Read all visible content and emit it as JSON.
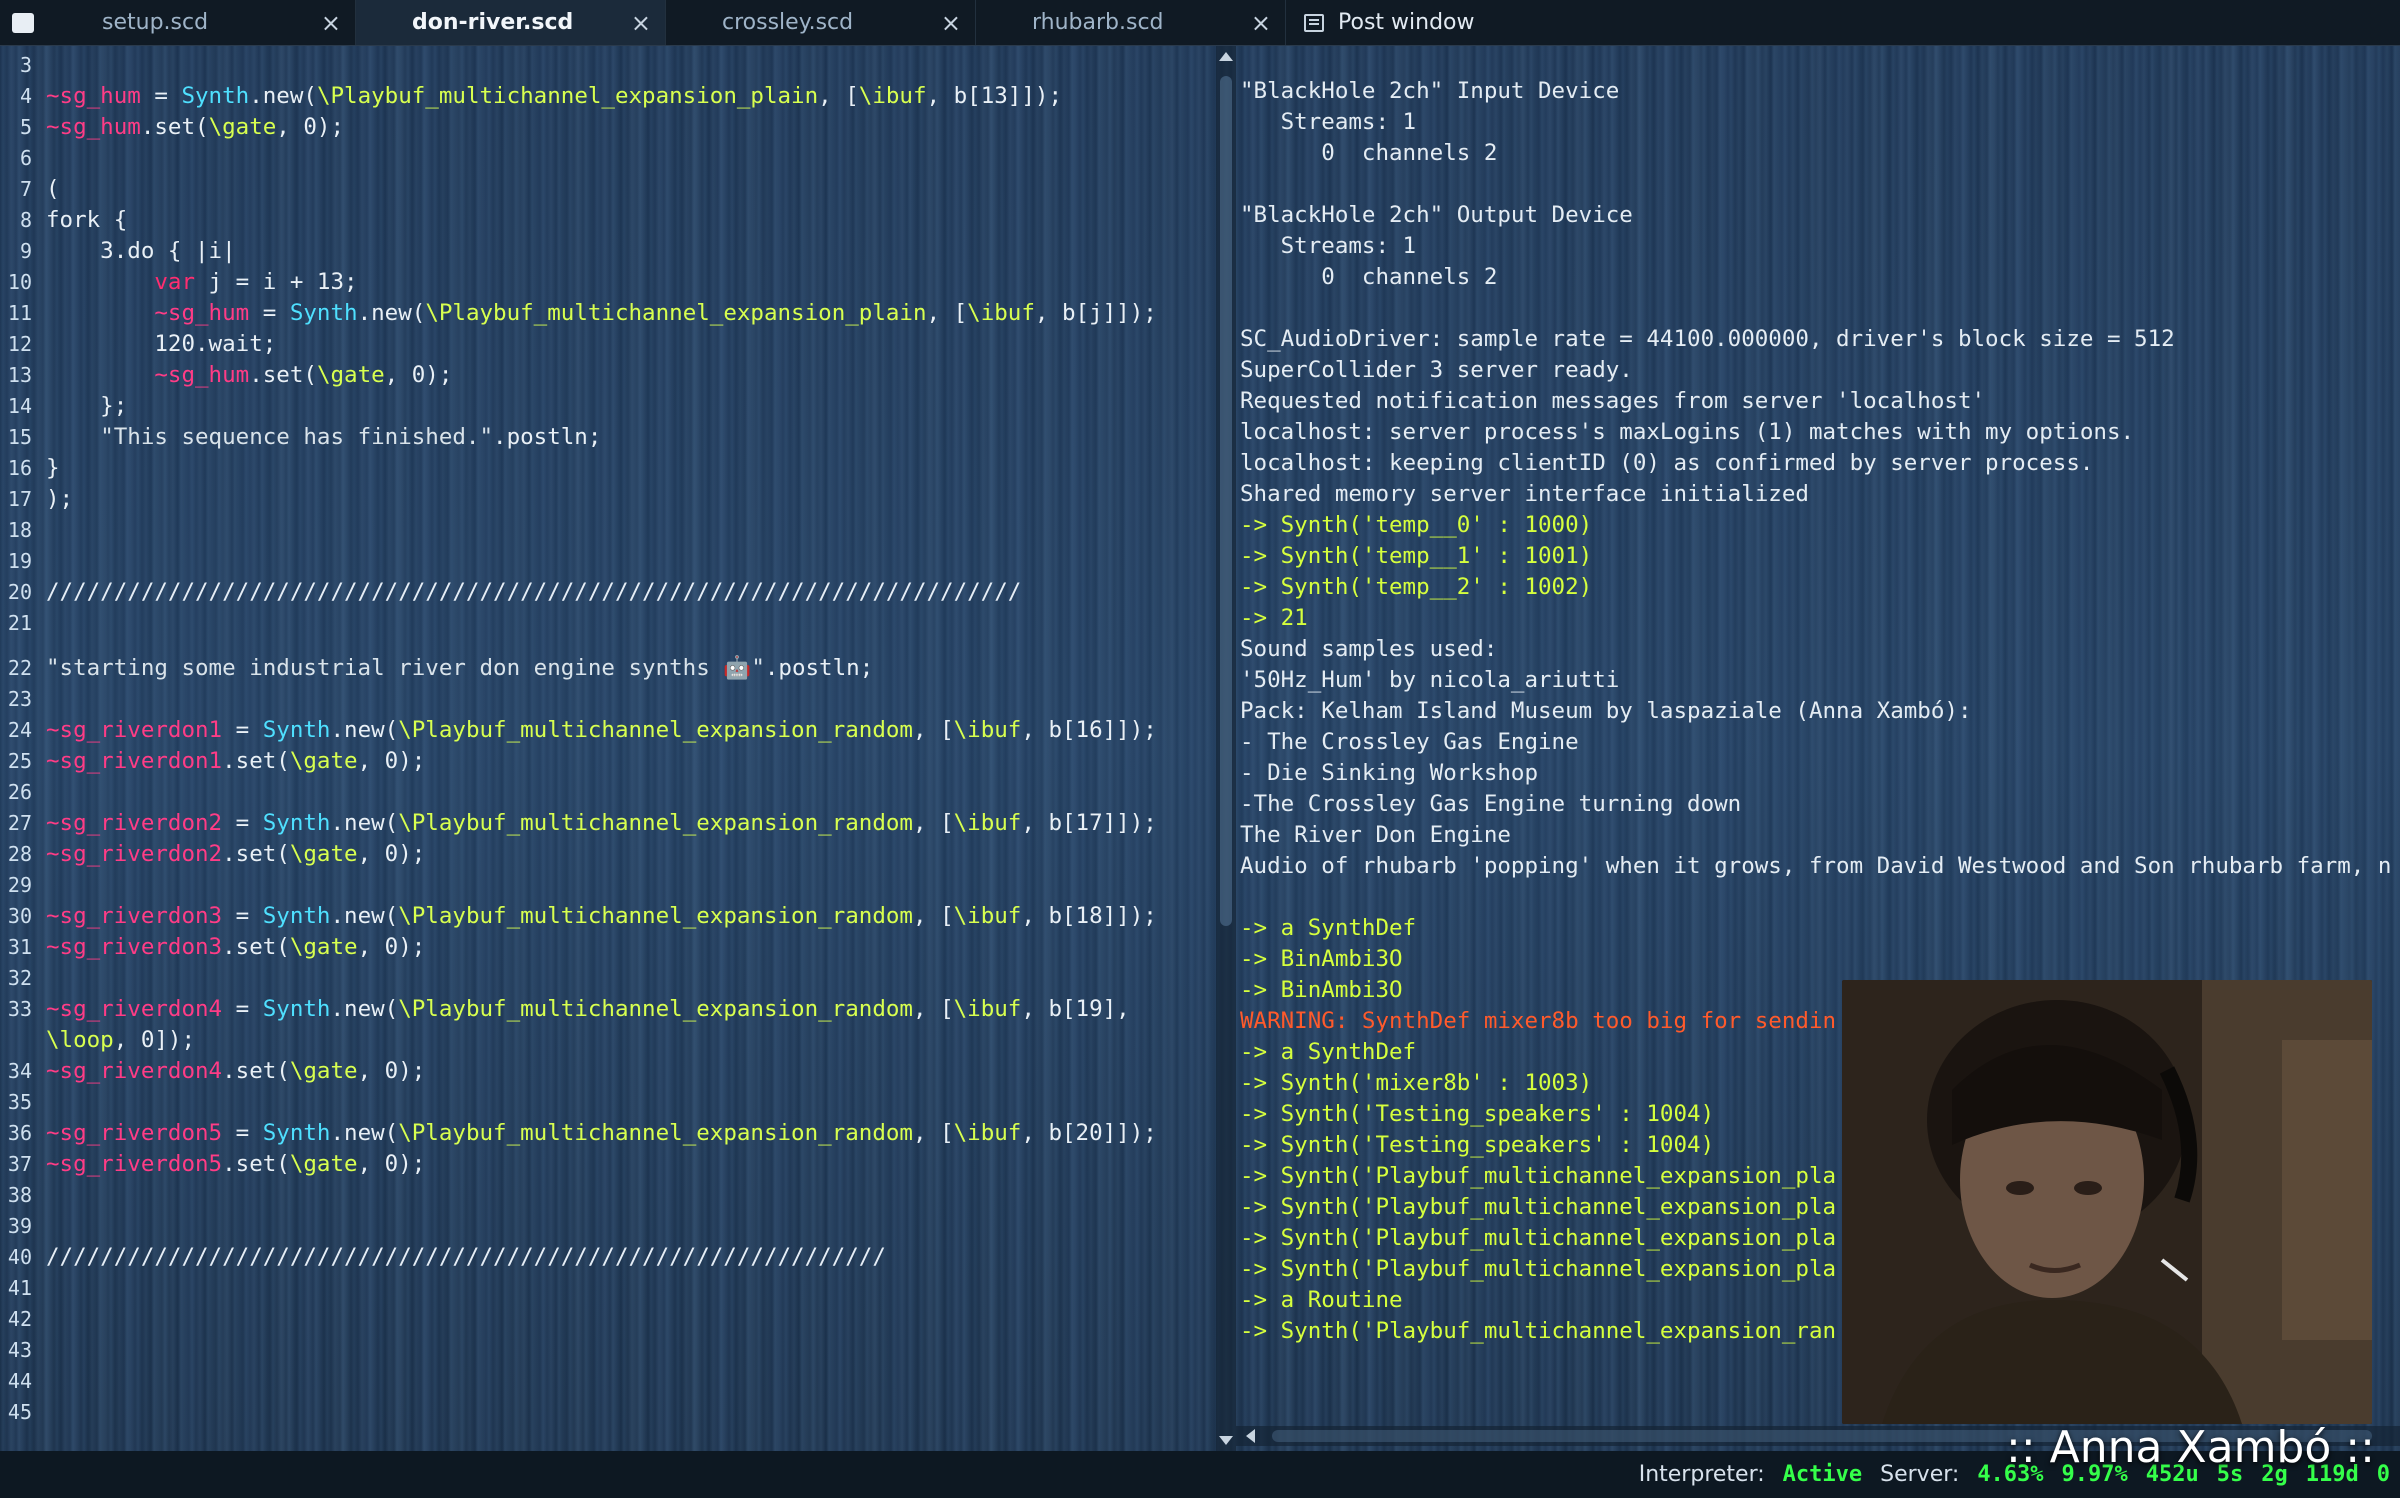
{
  "tabs": [
    {
      "label": "setup.scd",
      "close": "×"
    },
    {
      "label": "don-river.scd",
      "close": "×"
    },
    {
      "label": "crossley.scd",
      "close": "×"
    },
    {
      "label": "rhubarb.scd",
      "close": "×"
    }
  ],
  "post_window_tab": "Post window",
  "editor": {
    "lines": [
      {
        "n": "3",
        "text": ""
      },
      {
        "n": "4",
        "text": "~sg_hum = Synth.new(\\Playbuf_multichannel_expansion_plain, [\\ibuf, b[13]]);"
      },
      {
        "n": "5",
        "text": "~sg_hum.set(\\gate, 0);"
      },
      {
        "n": "6",
        "text": ""
      },
      {
        "n": "7",
        "text": "("
      },
      {
        "n": "8",
        "text": "fork {"
      },
      {
        "n": "9",
        "text": "    3.do { |i|"
      },
      {
        "n": "10",
        "text": "        var j = i + 13;"
      },
      {
        "n": "11",
        "text": "        ~sg_hum = Synth.new(\\Playbuf_multichannel_expansion_plain, [\\ibuf, b[j]]);"
      },
      {
        "n": "12",
        "text": "        120.wait;"
      },
      {
        "n": "13",
        "text": "        ~sg_hum.set(\\gate, 0);"
      },
      {
        "n": "14",
        "text": "    };"
      },
      {
        "n": "15",
        "text": "    \"This sequence has finished.\".postln;"
      },
      {
        "n": "16",
        "text": "}"
      },
      {
        "n": "17",
        "text": ");"
      },
      {
        "n": "18",
        "text": ""
      },
      {
        "n": "19",
        "text": ""
      },
      {
        "n": "20",
        "text": "////////////////////////////////////////////////////////////////////////"
      },
      {
        "n": "21",
        "text": ""
      },
      {
        "n": "22",
        "text": "\"starting some industrial river don engine synths 🤖\".postln;"
      },
      {
        "n": "23",
        "text": ""
      },
      {
        "n": "24",
        "text": "~sg_riverdon1 = Synth.new(\\Playbuf_multichannel_expansion_random, [\\ibuf, b[16]]);"
      },
      {
        "n": "25",
        "text": "~sg_riverdon1.set(\\gate, 0);"
      },
      {
        "n": "26",
        "text": ""
      },
      {
        "n": "27",
        "text": "~sg_riverdon2 = Synth.new(\\Playbuf_multichannel_expansion_random, [\\ibuf, b[17]]);"
      },
      {
        "n": "28",
        "text": "~sg_riverdon2.set(\\gate, 0);"
      },
      {
        "n": "29",
        "text": ""
      },
      {
        "n": "30",
        "text": "~sg_riverdon3 = Synth.new(\\Playbuf_multichannel_expansion_random, [\\ibuf, b[18]]);"
      },
      {
        "n": "31",
        "text": "~sg_riverdon3.set(\\gate, 0);"
      },
      {
        "n": "32",
        "text": ""
      },
      {
        "n": "33",
        "text": "~sg_riverdon4 = Synth.new(\\Playbuf_multichannel_expansion_random, [\\ibuf, b[19],"
      },
      {
        "n": "",
        "text": "\\loop, 0]);"
      },
      {
        "n": "34",
        "text": "~sg_riverdon4.set(\\gate, 0);"
      },
      {
        "n": "35",
        "text": ""
      },
      {
        "n": "36",
        "text": "~sg_riverdon5 = Synth.new(\\Playbuf_multichannel_expansion_random, [\\ibuf, b[20]]);"
      },
      {
        "n": "37",
        "text": "~sg_riverdon5.set(\\gate, 0);"
      },
      {
        "n": "38",
        "text": ""
      },
      {
        "n": "39",
        "text": ""
      },
      {
        "n": "40",
        "text": "//////////////////////////////////////////////////////////////"
      },
      {
        "n": "41",
        "text": ""
      },
      {
        "n": "42",
        "text": ""
      },
      {
        "n": "43",
        "text": ""
      },
      {
        "n": "44",
        "text": ""
      },
      {
        "n": "45",
        "text": ""
      }
    ]
  },
  "post_window": {
    "lines": [
      {
        "text": "\"BlackHole 2ch\" Input Device",
        "style": "plain"
      },
      {
        "text": "   Streams: 1",
        "style": "plain"
      },
      {
        "text": "      0  channels 2",
        "style": "plain"
      },
      {
        "text": "",
        "style": "plain"
      },
      {
        "text": "\"BlackHole 2ch\" Output Device",
        "style": "plain"
      },
      {
        "text": "   Streams: 1",
        "style": "plain"
      },
      {
        "text": "      0  channels 2",
        "style": "plain"
      },
      {
        "text": "",
        "style": "plain"
      },
      {
        "text": "SC_AudioDriver: sample rate = 44100.000000, driver's block size = 512",
        "style": "plain"
      },
      {
        "text": "SuperCollider 3 server ready.",
        "style": "plain"
      },
      {
        "text": "Requested notification messages from server 'localhost'",
        "style": "plain"
      },
      {
        "text": "localhost: server process's maxLogins (1) matches with my options.",
        "style": "plain"
      },
      {
        "text": "localhost: keeping clientID (0) as confirmed by server process.",
        "style": "plain"
      },
      {
        "text": "Shared memory server interface initialized",
        "style": "plain"
      },
      {
        "text": "-> Synth('temp__0' : 1000)",
        "style": "green"
      },
      {
        "text": "-> Synth('temp__1' : 1001)",
        "style": "green"
      },
      {
        "text": "-> Synth('temp__2' : 1002)",
        "style": "green"
      },
      {
        "text": "-> 21",
        "style": "green"
      },
      {
        "text": "Sound samples used:",
        "style": "plain"
      },
      {
        "text": "'50Hz_Hum' by nicola_ariutti",
        "style": "plain"
      },
      {
        "text": "Pack: Kelham Island Museum by laspaziale (Anna Xambó):",
        "style": "plain"
      },
      {
        "text": "- The Crossley Gas Engine",
        "style": "plain"
      },
      {
        "text": "- Die Sinking Workshop",
        "style": "plain"
      },
      {
        "text": "-The Crossley Gas Engine turning down",
        "style": "plain"
      },
      {
        "text": "The River Don Engine",
        "style": "plain"
      },
      {
        "text": "Audio of rhubarb 'popping' when it grows, from David Westwood and Son rhubarb farm, n",
        "style": "plain"
      },
      {
        "text": "",
        "style": "plain"
      },
      {
        "text": "-> a SynthDef",
        "style": "green"
      },
      {
        "text": "-> BinAmbi3O",
        "style": "green"
      },
      {
        "text": "-> BinAmbi3O",
        "style": "green"
      },
      {
        "text": "WARNING: SynthDef mixer8b too big for sendin",
        "style": "warn"
      },
      {
        "text": "-> a SynthDef",
        "style": "green"
      },
      {
        "text": "-> Synth('mixer8b' : 1003)",
        "style": "green"
      },
      {
        "text": "-> Synth('Testing_speakers' : 1004)",
        "style": "green"
      },
      {
        "text": "-> Synth('Testing_speakers' : 1004)",
        "style": "green"
      },
      {
        "text": "-> Synth('Playbuf_multichannel_expansion_pla",
        "style": "green"
      },
      {
        "text": "-> Synth('Playbuf_multichannel_expansion_pla",
        "style": "green"
      },
      {
        "text": "-> Synth('Playbuf_multichannel_expansion_pla",
        "style": "green"
      },
      {
        "text": "-> Synth('Playbuf_multichannel_expansion_pla",
        "style": "green"
      },
      {
        "text": "-> a Routine",
        "style": "green"
      },
      {
        "text": "-> Synth('Playbuf_multichannel_expansion_ran",
        "style": "green"
      }
    ]
  },
  "status": {
    "interpreter_label": "Interpreter:",
    "interpreter_state": "Active",
    "server_label": "Server:",
    "cpu_avg": "4.63%",
    "cpu_peak": "9.97%",
    "ugens": "452u",
    "synths": "5s",
    "groups": "2g",
    "synthdefs": "119d",
    "extra": "0"
  },
  "signature": ":: Anna Xambó ::",
  "icons": {
    "menu": "document-icon",
    "post": "post-window-icon"
  }
}
